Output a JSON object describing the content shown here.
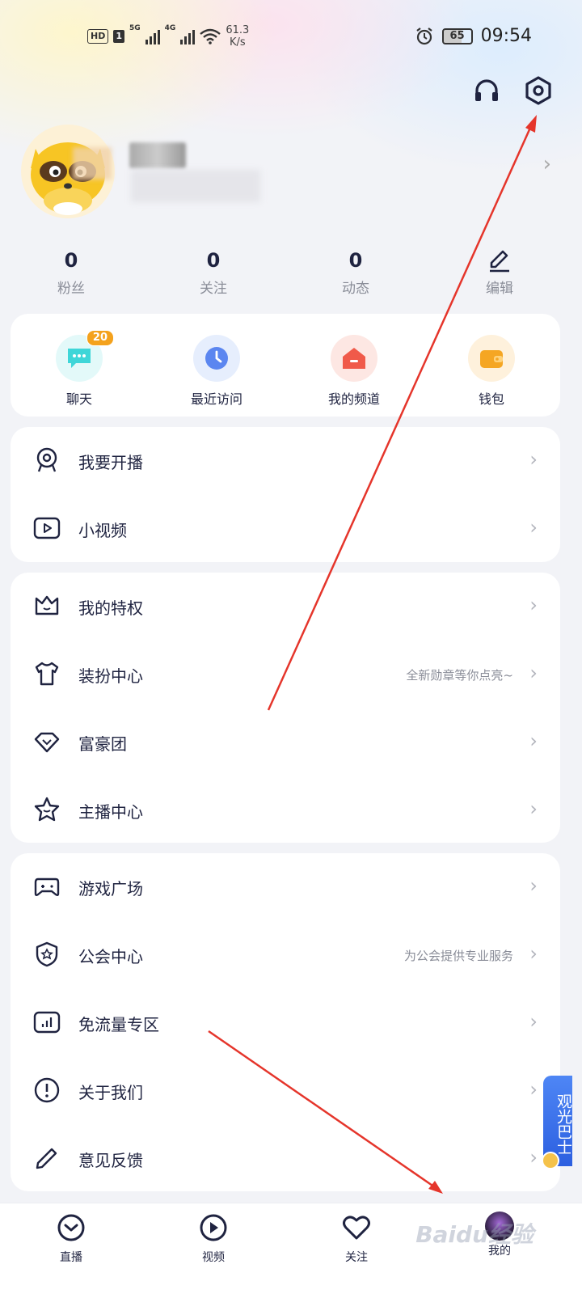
{
  "status_bar": {
    "hd": "HD",
    "sim": "1",
    "net1": "5G",
    "net2": "4G",
    "speed_value": "61.3",
    "speed_unit": "K/s",
    "battery": "65",
    "time": "09:54"
  },
  "header": {
    "icons": [
      "headphones-icon",
      "settings-icon"
    ]
  },
  "stats": [
    {
      "value": "0",
      "label": "粉丝"
    },
    {
      "value": "0",
      "label": "关注"
    },
    {
      "value": "0",
      "label": "动态"
    },
    {
      "value": "",
      "label": "编辑"
    }
  ],
  "quick_actions": [
    {
      "label": "聊天",
      "badge": "20",
      "icon": "chat-icon",
      "color": "#3fd6d8"
    },
    {
      "label": "最近访问",
      "badge": "",
      "icon": "clock-icon",
      "color": "#5b86f0"
    },
    {
      "label": "我的频道",
      "badge": "",
      "icon": "home-icon",
      "color": "#f05a4a"
    },
    {
      "label": "钱包",
      "badge": "",
      "icon": "wallet-icon",
      "color": "#f5a623"
    }
  ],
  "menu_group1": [
    {
      "label": "我要开播",
      "icon": "webcam-icon",
      "hint": ""
    },
    {
      "label": "小视频",
      "icon": "video-play-icon",
      "hint": ""
    }
  ],
  "menu_group2": [
    {
      "label": "我的特权",
      "icon": "crown-icon",
      "hint": ""
    },
    {
      "label": "装扮中心",
      "icon": "tshirt-icon",
      "hint": "全新勋章等你点亮~"
    },
    {
      "label": "富豪团",
      "icon": "diamond-icon",
      "hint": ""
    },
    {
      "label": "主播中心",
      "icon": "star-icon",
      "hint": ""
    }
  ],
  "menu_group3": [
    {
      "label": "游戏广场",
      "icon": "gamepad-icon",
      "hint": ""
    },
    {
      "label": "公会中心",
      "icon": "shield-icon",
      "hint": "为公会提供专业服务"
    },
    {
      "label": "免流量专区",
      "icon": "signal-card-icon",
      "hint": ""
    },
    {
      "label": "关于我们",
      "icon": "info-icon",
      "hint": ""
    },
    {
      "label": "意见反馈",
      "icon": "pen-icon",
      "hint": ""
    }
  ],
  "floating": {
    "label": "观光巴士"
  },
  "bottom_nav": [
    {
      "label": "直播",
      "icon": "live-icon"
    },
    {
      "label": "视频",
      "icon": "video-icon"
    },
    {
      "label": "关注",
      "icon": "heart-icon"
    },
    {
      "label": "我的",
      "icon": "avatar-icon",
      "active": true
    }
  ],
  "watermark": "Baidu经验",
  "colors": {
    "text": "#1f2340",
    "muted": "#8a8d98",
    "badge": "#f4a21d",
    "annotation_arrow": "#e5352b"
  }
}
